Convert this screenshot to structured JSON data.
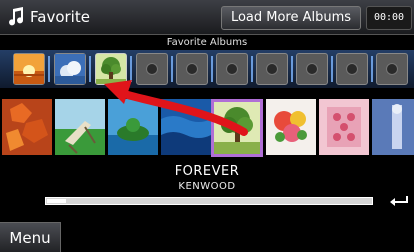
{
  "header": {
    "title": "Favorite",
    "load_more_label": "Load More Albums",
    "clock": "00:00"
  },
  "favorite_albums": {
    "label": "Favorite Albums",
    "slots": [
      {
        "art": "sunset"
      },
      {
        "art": "clouds"
      },
      {
        "art": "tree"
      },
      {
        "art": "empty"
      },
      {
        "art": "empty"
      },
      {
        "art": "empty"
      },
      {
        "art": "empty"
      },
      {
        "art": "empty"
      },
      {
        "art": "empty"
      },
      {
        "art": "empty"
      },
      {
        "art": "empty"
      }
    ]
  },
  "albums": [
    {
      "art": "autumn-leaves"
    },
    {
      "art": "beach-chair"
    },
    {
      "art": "island"
    },
    {
      "art": "water"
    },
    {
      "art": "tree",
      "selected": true
    },
    {
      "art": "flowers"
    },
    {
      "art": "rose-pattern"
    },
    {
      "art": "figure"
    }
  ],
  "now_playing": {
    "song": "FOREVER",
    "artist": "KENWOOD",
    "progress": 0.06
  },
  "menu_label": "Menu",
  "colors": {
    "selection": "#b06fd6",
    "arrow": "#e0141a",
    "favorite_strip": "#1e3458"
  }
}
